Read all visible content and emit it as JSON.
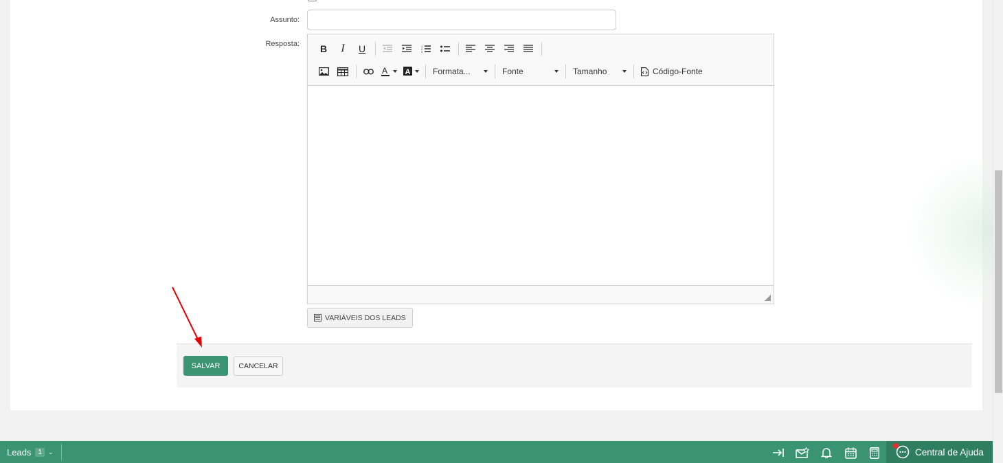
{
  "form": {
    "subject_label": "Assunto:",
    "subject_value": "",
    "response_label": "Resposta:",
    "variables_button": "VARIÁVEIS DOS LEADS"
  },
  "toolbar": {
    "format_label": "Formata...",
    "font_label": "Fonte",
    "size_label": "Tamanho",
    "source_label": "Código-Fonte"
  },
  "actions": {
    "save_label": "SALVAR",
    "cancel_label": "CANCELAR"
  },
  "bottom_bar": {
    "leads_label": "Leads",
    "leads_count": "1",
    "help_label": "Central de Ajuda"
  },
  "colors": {
    "primary": "#3a9472",
    "help_bg": "#2f7e60",
    "notification_dot": "#e63030",
    "arrow": "#e60000"
  }
}
